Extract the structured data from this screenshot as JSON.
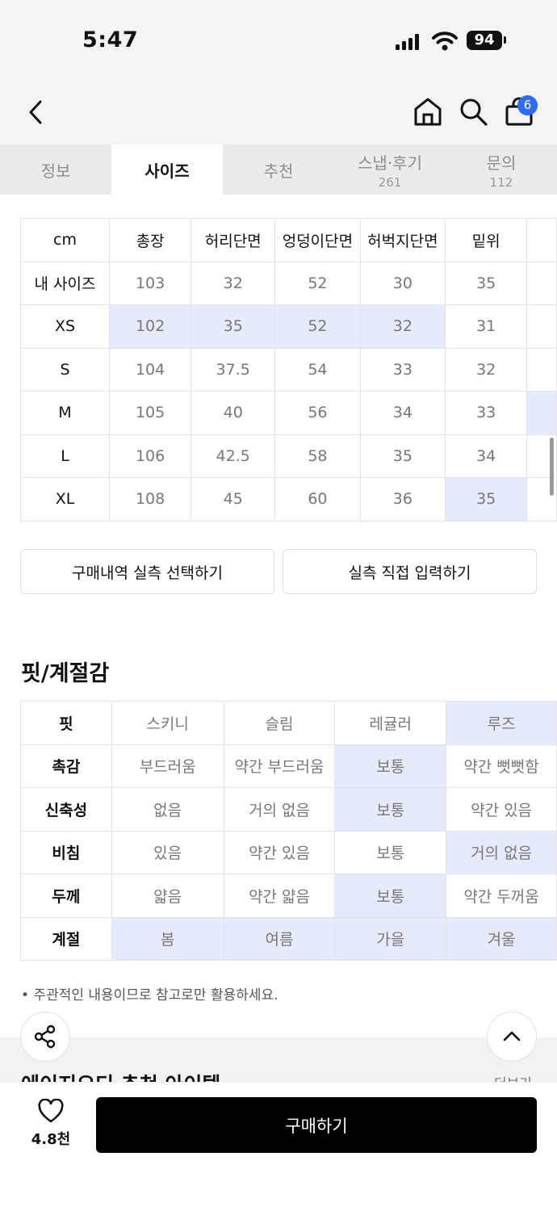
{
  "status": {
    "time": "5:47",
    "battery": "94"
  },
  "header": {
    "cart_count": "6"
  },
  "tabs": [
    {
      "label": "정보",
      "sub": ""
    },
    {
      "label": "사이즈",
      "sub": ""
    },
    {
      "label": "추천",
      "sub": ""
    },
    {
      "label": "스냅·후기",
      "sub": "261"
    },
    {
      "label": "문의",
      "sub": "112"
    }
  ],
  "size_table": {
    "columns": [
      "cm",
      "총장",
      "허리단면",
      "엉덩이단면",
      "허벅지단면",
      "밑위"
    ],
    "rows": [
      {
        "label": "내 사이즈",
        "values": [
          "103",
          "32",
          "52",
          "30",
          "35"
        ]
      },
      {
        "label": "XS",
        "values": [
          "102",
          "35",
          "52",
          "32",
          "31"
        ]
      },
      {
        "label": "S",
        "values": [
          "104",
          "37.5",
          "54",
          "33",
          "32"
        ]
      },
      {
        "label": "M",
        "values": [
          "105",
          "40",
          "56",
          "34",
          "33"
        ]
      },
      {
        "label": "L",
        "values": [
          "106",
          "42.5",
          "58",
          "35",
          "34"
        ]
      },
      {
        "label": "XL",
        "values": [
          "108",
          "45",
          "60",
          "36",
          "35"
        ]
      }
    ]
  },
  "buttons": {
    "purchase_history": "구매내역 실측 선택하기",
    "manual_input": "실측 직접 입력하기",
    "buy": "구매하기"
  },
  "fit_section": {
    "title": "핏/계절감",
    "rows": [
      {
        "label": "핏",
        "values": [
          "스키니",
          "슬림",
          "레귤러",
          "루즈"
        ]
      },
      {
        "label": "촉감",
        "values": [
          "부드러움",
          "약간 부드러움",
          "보통",
          "약간 뻣뻣함"
        ]
      },
      {
        "label": "신축성",
        "values": [
          "없음",
          "거의 없음",
          "보통",
          "약간 있음"
        ]
      },
      {
        "label": "비침",
        "values": [
          "있음",
          "약간 있음",
          "보통",
          "거의 없음"
        ]
      },
      {
        "label": "두께",
        "values": [
          "얇음",
          "약간 얇음",
          "보통",
          "약간 두꺼움"
        ]
      },
      {
        "label": "계절",
        "values": [
          "봄",
          "여름",
          "가을",
          "겨울"
        ]
      }
    ],
    "note": "• 주관적인 내용이므로 참고로만 활용하세요."
  },
  "recommend": {
    "title": "에이지오디 추천 아이템",
    "more": "더보기"
  },
  "like": {
    "count": "4.8천"
  },
  "colors": {
    "highlight": "#e6ebfc",
    "badge": "#2f6bff",
    "buy": "#000000"
  }
}
